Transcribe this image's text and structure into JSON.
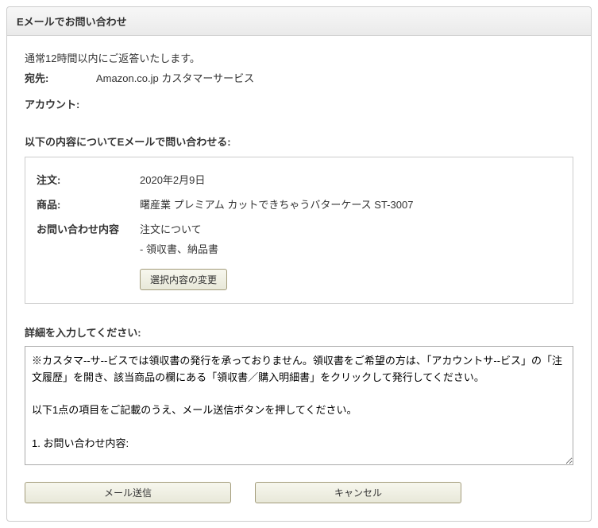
{
  "header": {
    "title": "Eメールでお問い合わせ"
  },
  "intro": {
    "response_time": "通常12時間以内にご返答いたします。",
    "to_label": "宛先:",
    "to_value": "Amazon.co.jp カスタマーサービス",
    "account_label": "アカウント:"
  },
  "inquiry": {
    "intro": "以下の内容についてEメールで問い合わせる:",
    "rows": {
      "order_label": "注文:",
      "order_value": "2020年2月9日",
      "product_label": "商品:",
      "product_value": "曙産業 プレミアム カットできちゃうバターケース ST-3007",
      "content_label": "お問い合わせ内容",
      "content_value": "注文について",
      "content_sub": "- 領収書、納品書"
    },
    "change_button": "選択内容の変更"
  },
  "details": {
    "label": "詳細を入力してください:",
    "textarea_value": "※カスタマ--サ--ビスでは領収書の発行を承っておりません。領収書をご希望の方は、「アカウントサ--ビス」の「注文履歴」を開き、該当商品の欄にある「領収書／購入明細書」をクリックして発行してください。\n\n以下1点の項目をご記載のうえ、メール送信ボタンを押してください。\n\n1. お問い合わせ内容:"
  },
  "actions": {
    "send": "メール送信",
    "cancel": "キャンセル"
  }
}
